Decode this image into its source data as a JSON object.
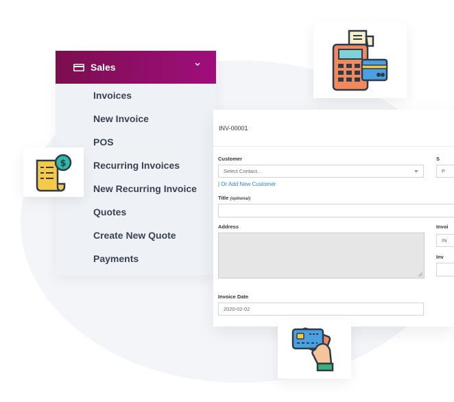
{
  "sidebar": {
    "header_label": "Sales",
    "items": [
      {
        "label": "Invoices"
      },
      {
        "label": "New Invoice"
      },
      {
        "label": "POS"
      },
      {
        "label": "Recurring Invoices"
      },
      {
        "label": "New Recurring Invoice"
      },
      {
        "label": "Quotes"
      },
      {
        "label": "Create New Quote"
      },
      {
        "label": "Payments"
      }
    ]
  },
  "form": {
    "invoice_number": "INV-00001",
    "customer_label": "Customer",
    "customer_select_value": "Select Contact...",
    "add_customer_link": "| Or Add New Customer",
    "title_label": "Title",
    "title_optional": "(optional)",
    "title_value": "",
    "address_label": "Address",
    "address_value": "",
    "invoice_date_label": "Invoice Date",
    "invoice_date_value": "2020-02-02",
    "right_col": {
      "label_top": "S",
      "input_top_value": "P",
      "label_invoice": "Invoi",
      "input_invoice_value": "IN",
      "label_inv": "Inv",
      "input_inv_value": ""
    }
  },
  "colors": {
    "header_start": "#7b0e4e",
    "header_end": "#a00e7c",
    "link": "#2a86c9",
    "menu_text": "#3a4252"
  },
  "icons": {
    "sales_icon": "credit-card-icon",
    "chevron": "chevron-down-icon",
    "pos_terminal": "pos-terminal-icon",
    "receipt": "receipt-dollar-icon",
    "card_in_hand": "card-in-hand-icon"
  }
}
